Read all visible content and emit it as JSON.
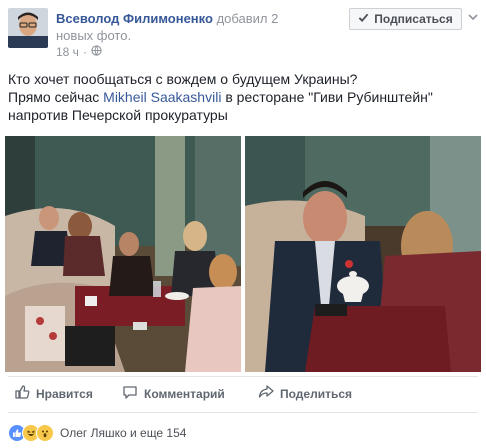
{
  "header": {
    "author": "Всеволод Филимоненко",
    "action_line1": " добавил 2",
    "action_line2": "новых фото.",
    "time": "18 ч",
    "sep": "·",
    "follow_label": "Подписаться"
  },
  "post": {
    "line1": "Кто хочет пообщаться с вождем о будущем Украины?",
    "line2_before": "Прямо сейчас ",
    "mention": "Mikheil Saakashvili",
    "line2_after": " в ресторане \"Гиви Рубинштейн\"",
    "line3": "напротив Печерской прокуратуры"
  },
  "actions": {
    "like": "Нравится",
    "comment": "Комментарий",
    "share": "Поделиться"
  },
  "reactions": {
    "summary": "Олег Ляшко и еще 154"
  },
  "icons": [
    "globe-icon",
    "check-icon",
    "chevron-down-icon",
    "like-icon",
    "comment-icon",
    "share-icon",
    "reaction-like-icon",
    "reaction-haha-icon",
    "reaction-wow-icon"
  ],
  "colors": {
    "link": "#365899",
    "muted": "#90949c",
    "like_blue": "#5890ff"
  }
}
